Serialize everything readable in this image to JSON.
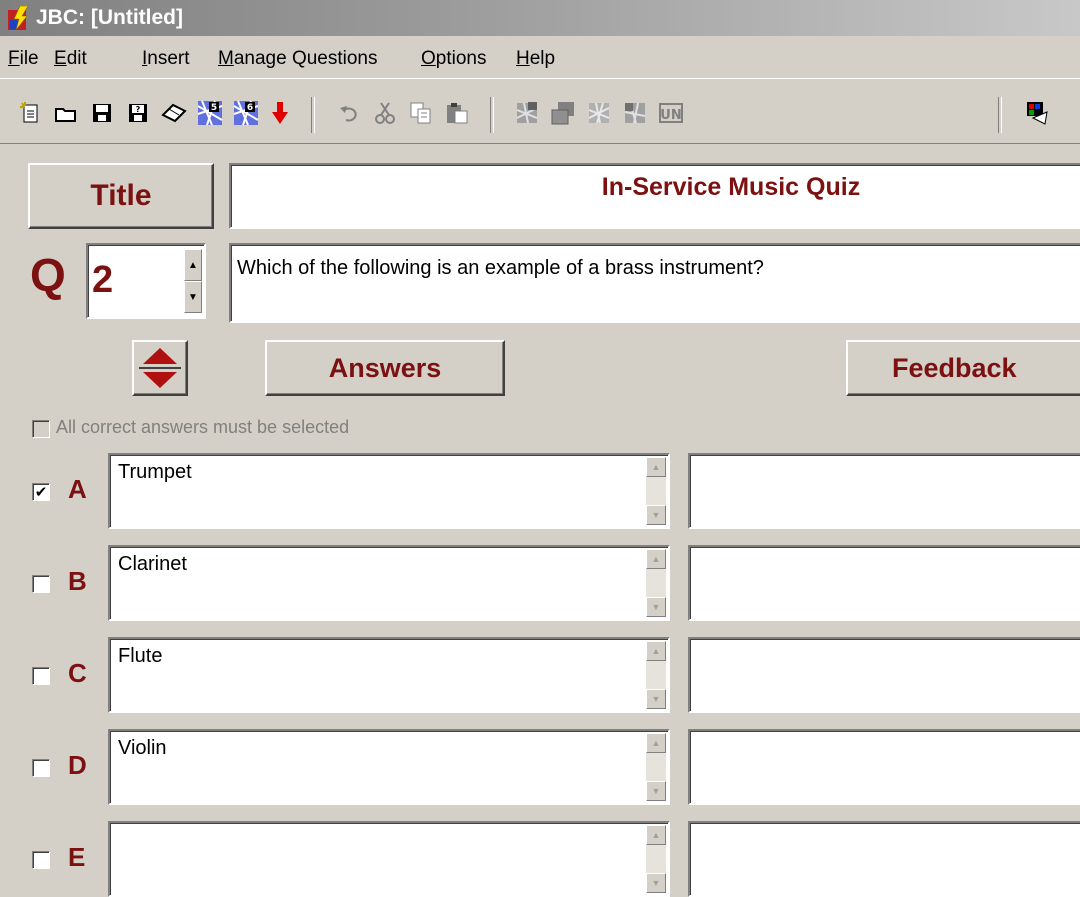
{
  "window": {
    "title": "JBC: [Untitled]"
  },
  "menu": [
    {
      "id": "file",
      "label": "File"
    },
    {
      "id": "edit",
      "label": "Edit"
    },
    {
      "id": "insert",
      "label": "Insert"
    },
    {
      "id": "manage",
      "label": "Manage Questions"
    },
    {
      "id": "options",
      "label": "Options"
    },
    {
      "id": "help",
      "label": "Help"
    }
  ],
  "toolbar": {
    "icons": [
      "new-file-icon",
      "open-folder-icon",
      "save-icon",
      "save-as-icon",
      "eraser-icon",
      "export-5-icon",
      "export-6-icon",
      "down-arrow-icon",
      "undo-icon",
      "cut-icon",
      "copy-icon",
      "paste-icon",
      "tool-a-icon",
      "tool-b-icon",
      "tool-c-icon",
      "tool-d-icon",
      "tool-e-icon",
      "tool-f-icon"
    ]
  },
  "quiz": {
    "title_button": "Title",
    "title_value": "In-Service Music Quiz",
    "q_label": "Q",
    "question_number": "2",
    "question_text": "Which of the following is an example of a brass instrument?",
    "answers_button": "Answers",
    "feedback_button": "Feedback",
    "all_correct_label": "All correct answers must be selected",
    "all_correct_checked": false
  },
  "answers": [
    {
      "letter": "A",
      "text": "Trumpet",
      "checked": true,
      "feedback": ""
    },
    {
      "letter": "B",
      "text": "Clarinet",
      "checked": false,
      "feedback": ""
    },
    {
      "letter": "C",
      "text": "Flute",
      "checked": false,
      "feedback": ""
    },
    {
      "letter": "D",
      "text": "Violin",
      "checked": false,
      "feedback": ""
    },
    {
      "letter": "E",
      "text": "",
      "checked": false,
      "feedback": ""
    }
  ],
  "colors": {
    "accent": "#7b1111",
    "face": "#d4d0c8"
  }
}
